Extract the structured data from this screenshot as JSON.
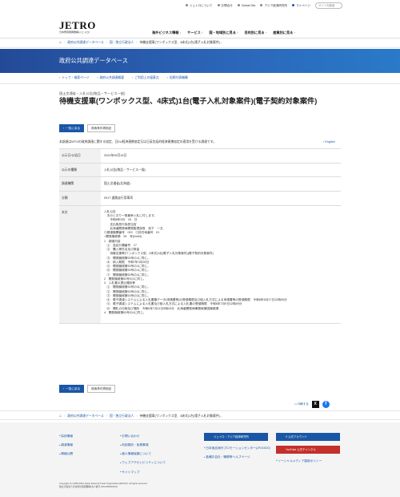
{
  "topbar": {
    "about": "ジェトロについて",
    "contact": "お問合せ",
    "global_site": "Global Site",
    "ide": "アジア経済研究所",
    "mypage": "マイページ",
    "search_placeholder": "サイト内検索"
  },
  "header": {
    "logo": "JETRO",
    "logo_sub": "日本貿易振興機構(ジェトロ)",
    "nav": [
      "海外ビジネス情報",
      "サービス",
      "国・地域別に見る",
      "目的別に見る",
      "産業別に見る"
    ]
  },
  "breadcrumb": [
    "政府公共調達データベース",
    "国・独立行政法人",
    "待機支援車(ワンボックス型、4床式)1台(電子入札対象案件)..."
  ],
  "banner_title": "政府公共調達データベース",
  "subnav": [
    "トップ・検索ページ",
    "政府公共調達概要",
    "ご利用上の留意点",
    "但締付表機構"
  ],
  "category": "国土交通省・入札公告(物品・サービス一般)",
  "title": "待機支援車(ワンボックス型、4床式)1台(電子入札対象案件)(電子契約対象案件)",
  "buttons": {
    "back_to_list": "一覧に戻る",
    "search_conditions": "検索条件再指定"
  },
  "note": "本調達はWTOの政府調達に関する協定、日EU経済連携協定又は日英包括的経済連携協定の適用を受ける調達です。",
  "english_link": "English",
  "details": [
    {
      "label": "公示日/公告日",
      "value": "2024年05月16日"
    },
    {
      "label": "公示の種類",
      "value": "入札公告(物品・サービス一般)"
    },
    {
      "label": "調達機関",
      "value": "国土交通省(北海道)"
    },
    {
      "label": "分類",
      "value": "0017 道路走行用車両"
    }
  ],
  "body_label": "本文",
  "body_text": "入札公告\n　次のとおり一般競争入札に付します。\n　　令和6年5月　16　日\n　　支出負担行為担当官\n　　北海道開発局開発監理部長　池下　一文\n◎調達機関番号　020　◎所在地番号　01\n○開発機械第　54　号(No54)\n1　調達内容\n　⑴　品目分類番号　17\n　⑵　購入等件名及び数量\n　　待機支援車(ワンボックス型、4床式)1台(電子入札対象案件)(電子契約対象案件)\n　⑶　開発機械第53号の1に同じ。\n　⑷　納入期限　令和7年3月28日\n　⑸　開発機械第53号の1に同じ。\n　⑹　開発機械第53号の1に同じ。\n　⑺　開発機械第53号の1に同じ。\n2　開発機械第53号の2に同じ。\n3　入札書の提出場所等\n　⑴　開発機械第53号の3に同じ。\n　⑵　開発機械第53号の3に同じ。\n　⑶　開発機械第53号の3に同じ。\n　⑷　電子調達システムによる入札書類データ(申請書等)の受領期限及び紙入札方式による申請書等の受領期限　令和6年6月17日12時00分\n　⑸　電子調達システムによる入札書及び紙入札方式による入札書の受領期限　令和6年7月9日12時00分\n　⑹　開札の日時及び場所　令和6年7月11日9時20分　北海道開発局事務局第図機械課\n4　開発機械第53号の4に同じ。",
  "share": {
    "print": "印刷する",
    "x": "X",
    "facebook": "f"
  },
  "footer": {
    "col1": [
      "採用情報",
      "調達情報",
      "情報公開"
    ],
    "col2": [
      "お問い合わせ",
      "利用規約・免責事項",
      "個人情報保護について",
      "ウェブアクセシビリティについて",
      "サイトマップ"
    ],
    "col3_button": "ジェトロ・アジア経済研究所",
    "col3": [
      "日本食品海外プロモーションセンター(JFOODO)",
      "各種お会社・職務等ヘルプページ"
    ],
    "col4_buttons": [
      "X 公式アカウント",
      "YouTube 公式チャンネル"
    ],
    "col4": [
      "ソーシャルメディア運用ポリシー"
    ],
    "copyright_1": "Copyright (C) 1995-2024 Japan External Trade Organization(JETRO). All rights reserved.",
    "copyright_2": "独立行政法人日本貿易振興機構(法人番号 2010405004021)"
  },
  "colors": {
    "brand_blue": "#1a56a6",
    "banner_blue": "#2b65b8",
    "youtube_red": "#c4302b"
  }
}
